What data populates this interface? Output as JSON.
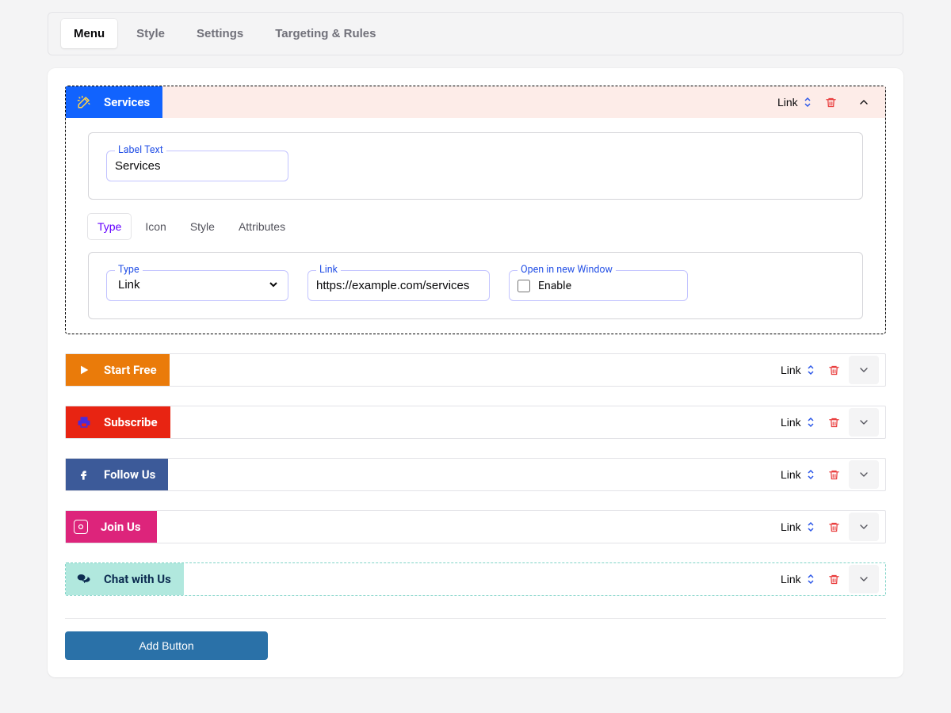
{
  "topnav": {
    "tabs": [
      "Menu",
      "Style",
      "Settings",
      "Targeting & Rules"
    ],
    "active": 0
  },
  "items": [
    {
      "label": "Services",
      "type": "Link",
      "color": "#1163fe",
      "expanded": true,
      "label_legend": "Label Text",
      "subtabs": [
        "Type",
        "Icon",
        "Style",
        "Attributes"
      ],
      "subtab_active": 0,
      "type_legend": "Type",
      "type_value": "Link",
      "link_legend": "Link",
      "link_value": "https://example.com/services",
      "openwin_legend": "Open in new Window",
      "openwin_label": "Enable",
      "openwin_checked": false
    },
    {
      "label": "Start Free",
      "type": "Link",
      "color": "#ea7b0a",
      "expanded": false,
      "icon": "play"
    },
    {
      "label": "Subscribe",
      "type": "Link",
      "color": "#e82412",
      "expanded": false,
      "icon": "printer"
    },
    {
      "label": "Follow Us",
      "type": "Link",
      "color": "#3c5a99",
      "expanded": false,
      "icon": "facebook"
    },
    {
      "label": "Join Us",
      "type": "Link",
      "color": "#dd247b",
      "expanded": false,
      "icon": "instagram"
    },
    {
      "label": "Chat with Us",
      "type": "Link",
      "color": "#b1e8de",
      "textcolor": "#0d2d52",
      "expanded": false,
      "dashed": true,
      "icon": "chat"
    }
  ],
  "footer": {
    "add_button": "Add Button"
  }
}
